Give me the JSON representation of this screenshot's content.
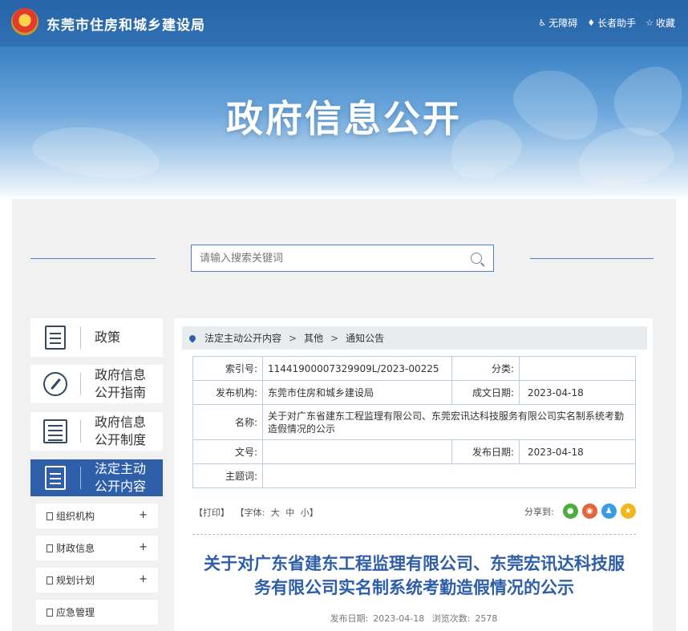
{
  "header": {
    "site_title": "东莞市住房和城乡建设局",
    "tools": [
      {
        "icon": "accessibility-icon",
        "label": "无障碍"
      },
      {
        "icon": "elder-assist-icon",
        "label": "长者助手"
      },
      {
        "icon": "star-icon",
        "label": "收藏"
      }
    ],
    "banner_title": "政府信息公开"
  },
  "search": {
    "placeholder": "请输入搜索关键词"
  },
  "sidebar": {
    "items": [
      {
        "icon": "document-icon",
        "label_line1": "政策",
        "label_line2": ""
      },
      {
        "icon": "compass-icon",
        "label_line1": "政府信息",
        "label_line2": "公开指南"
      },
      {
        "icon": "list-document-icon",
        "label_line1": "政府信息",
        "label_line2": "公开制度"
      },
      {
        "icon": "document-icon",
        "label_line1": "法定主动",
        "label_line2": "公开内容",
        "active": true
      }
    ],
    "sub_items": [
      {
        "label": "组织机构",
        "toggle": "+"
      },
      {
        "label": "财政信息",
        "toggle": "+"
      },
      {
        "label": "规划计划",
        "toggle": "+"
      },
      {
        "label": "应急管理",
        "toggle": ""
      }
    ]
  },
  "breadcrumb": {
    "items": [
      "法定主动公开内容",
      "其他",
      "通知公告"
    ],
    "separator": ">"
  },
  "meta_table": {
    "index_label": "索引号:",
    "index_value": "11441900007329909L/2023-00225",
    "category_label": "分类:",
    "category_value": "",
    "publisher_label": "发布机构:",
    "publisher_value": "东莞市住房和城乡建设局",
    "created_label": "成文日期:",
    "created_value": "2023-04-18",
    "name_label": "名称:",
    "name_value": "关于对广东省建东工程监理有限公司、东莞宏讯达科技服务有限公司实名制系统考勤造假情况的公示",
    "docno_label": "文号:",
    "docno_value": "",
    "published_label": "发布日期:",
    "published_value": "2023-04-18",
    "keywords_label": "主题词:",
    "keywords_value": ""
  },
  "options": {
    "print": "【打印】",
    "font_label": "【字体:",
    "font_large": "大",
    "font_medium": "中",
    "font_small": "小】",
    "share_label": "分享到:"
  },
  "share_buttons": [
    {
      "icon": "wechat-icon",
      "color": "#4cae3c"
    },
    {
      "icon": "weibo-icon",
      "color": "#e5643c"
    },
    {
      "icon": "qq-icon",
      "color": "#3a9de3"
    },
    {
      "icon": "qzone-icon",
      "color": "#f2b51b"
    }
  ],
  "article": {
    "title_line1": "关于对广东省建东工程监理有限公司、东莞宏讯达科技服",
    "title_line2": "务有限公司实名制系统考勤造假情况的公示",
    "date_label": "发布日期:",
    "date_value": "2023-04-18",
    "views_label": "浏览次数:",
    "views_value": "2578"
  },
  "colors": {
    "brand_blue": "#2f5fa8",
    "title_blue": "#2e5ea8",
    "table_border": "#b9cde4",
    "panel_gray": "#f1f1f1"
  }
}
